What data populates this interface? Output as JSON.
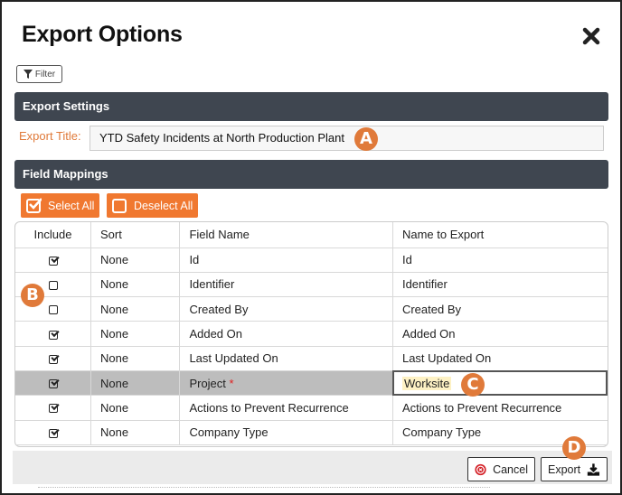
{
  "dialog": {
    "title": "Export Options",
    "close_icon": "close-icon",
    "filter_label": "Filter"
  },
  "export_settings": {
    "header": "Export Settings",
    "title_label": "Export Title:",
    "title_value": "YTD Safety Incidents at North Production Plant"
  },
  "field_mappings": {
    "header": "Field Mappings",
    "select_all_label": "Select All",
    "deselect_all_label": "Deselect All",
    "columns": [
      "Include",
      "Sort",
      "Field Name",
      "Name to Export"
    ],
    "rows": [
      {
        "include": true,
        "sort": "None",
        "field_name": "Id",
        "export_name": "Id",
        "required": false
      },
      {
        "include": false,
        "sort": "None",
        "field_name": "Identifier",
        "export_name": "Identifier",
        "required": false
      },
      {
        "include": false,
        "sort": "None",
        "field_name": "Created By",
        "export_name": "Created By",
        "required": false
      },
      {
        "include": true,
        "sort": "None",
        "field_name": "Added On",
        "export_name": "Added On",
        "required": false
      },
      {
        "include": true,
        "sort": "None",
        "field_name": "Last Updated On",
        "export_name": "Last Updated On",
        "required": false
      },
      {
        "include": true,
        "sort": "None",
        "field_name": "Project",
        "export_name": "Worksite",
        "required": true,
        "selected": true
      },
      {
        "include": true,
        "sort": "None",
        "field_name": "Actions to Prevent Recurrence",
        "export_name": "Actions to Prevent Recurrence",
        "required": false
      },
      {
        "include": true,
        "sort": "None",
        "field_name": "Company Type",
        "export_name": "Company Type",
        "required": false
      }
    ],
    "required_marker": "*"
  },
  "footer": {
    "cancel_label": "Cancel",
    "export_label": "Export"
  },
  "callouts": {
    "a": "A",
    "b": "B",
    "c": "C",
    "d": "D"
  },
  "colors": {
    "accent_orange": "#f07830",
    "callout_orange": "#e07a3a",
    "section_header": "#3f4650",
    "selected_row": "#bdbdbd",
    "required_red": "#e02020",
    "cancel_red": "#d42027"
  }
}
